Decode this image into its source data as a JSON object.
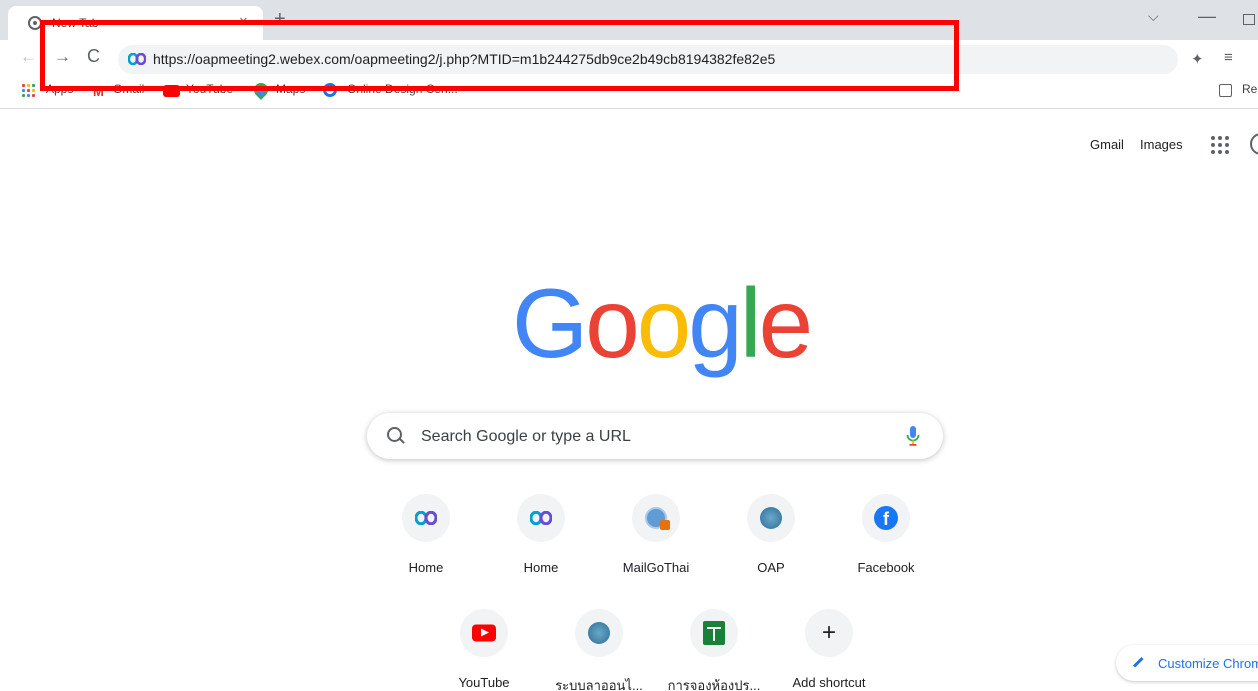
{
  "browser": {
    "tab": {
      "title": "New Tab",
      "close": "×"
    },
    "new_tab": "+",
    "window": {
      "search_tabs": "⌵",
      "minimize": "—"
    },
    "nav": {
      "back": "←",
      "forward": "→",
      "reload": "C"
    },
    "address_bar": {
      "url": "https://oapmeeting2.webex.com/oapmeeting2/j.php?MTID=m1b244275db9ce2b49cb8194382fe82e5"
    },
    "bookmarks": [
      {
        "label": "Apps",
        "icon": "apps-grid-icon"
      },
      {
        "label": "Gmail",
        "icon": "gmail-icon"
      },
      {
        "label": "YouTube",
        "icon": "youtube-icon"
      },
      {
        "label": "Maps",
        "icon": "maps-icon"
      },
      {
        "label": "Online Design Cen...",
        "icon": "online-design-icon"
      }
    ],
    "reading_list": "Re"
  },
  "header_links": {
    "gmail": "Gmail",
    "images": "Images"
  },
  "logo": {
    "letters": [
      "G",
      "o",
      "o",
      "g",
      "l",
      "e"
    ],
    "colors": [
      "#4285F4",
      "#EA4335",
      "#FBBC05",
      "#4285F4",
      "#34A853",
      "#EA4335"
    ]
  },
  "search": {
    "placeholder": "Search Google or type a URL"
  },
  "shortcuts": [
    {
      "label": "Home",
      "icon": "webex-icon"
    },
    {
      "label": "Home",
      "icon": "webex-icon"
    },
    {
      "label": "MailGoThai",
      "icon": "mailgothai-icon"
    },
    {
      "label": "OAP",
      "icon": "oap-icon"
    },
    {
      "label": "Facebook",
      "icon": "facebook-icon"
    },
    {
      "label": "YouTube",
      "icon": "youtube-icon"
    },
    {
      "label": "ระบบลาออนไ...",
      "icon": "oap-icon"
    },
    {
      "label": "การจองห้องปร...",
      "icon": "google-sheets-icon"
    },
    {
      "label": "Add shortcut",
      "icon": "plus-icon"
    }
  ],
  "customize": {
    "label": "Customize Chrome"
  },
  "colors": {
    "highlight": "#FF0000",
    "accent": "#1A73E8"
  }
}
